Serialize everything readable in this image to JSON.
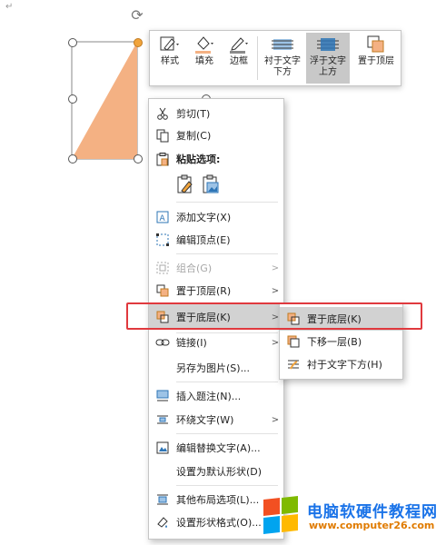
{
  "canvas": {
    "return_mark": "↵"
  },
  "colors": {
    "shape_fill": "#f4b183",
    "accent_red": "#e0393e",
    "hover": "#d2d2d2"
  },
  "mini_toolbar": {
    "buttons": [
      {
        "label": "样式",
        "icon": "style-brush-icon"
      },
      {
        "label": "填充",
        "icon": "fill-bucket-icon"
      },
      {
        "label": "边框",
        "icon": "outline-pen-icon"
      },
      {
        "label": "衬于文字\n下方",
        "icon": "behind-text-icon"
      },
      {
        "label": "浮于文字\n上方",
        "icon": "in-front-text-icon",
        "active": true
      },
      {
        "label": "置于顶层",
        "icon": "bring-front-icon"
      }
    ],
    "b1": "样式",
    "b2": "填充",
    "b3": "边框",
    "b4a": "衬于文字",
    "b4b": "下方",
    "b5a": "浮于文字",
    "b5b": "上方",
    "b6": "置于顶层"
  },
  "context_menu": {
    "cut": "剪切(T)",
    "copy": "复制(C)",
    "paste_options": "粘贴选项:",
    "add_text": "添加文字(X)",
    "edit_points": "编辑顶点(E)",
    "group": "组合(G)",
    "bring_to_front": "置于顶层(R)",
    "send_to_back": "置于底层(K)",
    "link": "链接(I)",
    "save_as_picture": "另存为图片(S)...",
    "insert_caption": "插入题注(N)...",
    "wrap_text": "环绕文字(W)",
    "edit_alt_text": "编辑替换文字(A)...",
    "set_default_shape": "设置为默认形状(D)",
    "more_layout": "其他布局选项(L)...",
    "format_shape": "设置形状格式(O)..."
  },
  "submenu": {
    "send_to_back": "置于底层(K)",
    "send_backward": "下移一层(B)",
    "behind_text": "衬于文字下方(H)"
  },
  "watermark": {
    "title": "电脑软硬件教程网",
    "url": "www.computer26.com"
  }
}
